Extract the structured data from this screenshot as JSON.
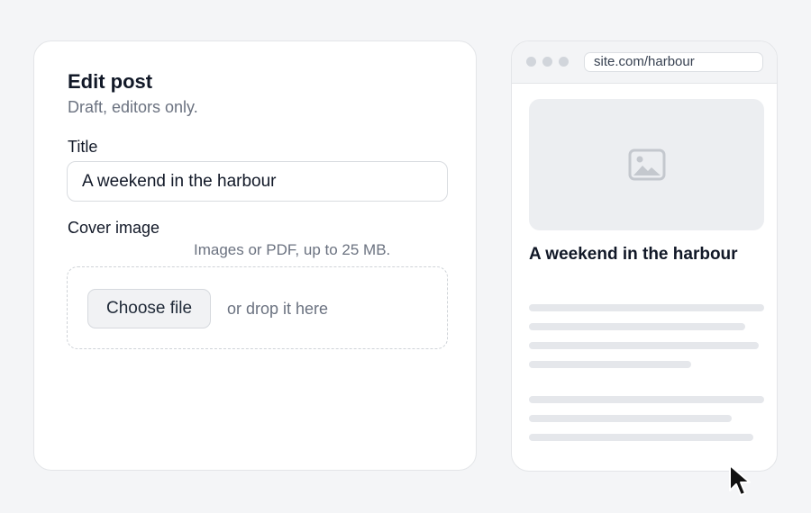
{
  "editor": {
    "title": "Edit post",
    "subtitle": "Draft, editors only.",
    "title_label": "Title",
    "title_value": "A weekend in the harbour",
    "cover_label": "Cover image",
    "cover_hint": "Images or PDF, up to 25 MB.",
    "choose_file_label": "Choose file",
    "drop_text": "or drop it here"
  },
  "preview": {
    "url": "site.com/harbour",
    "image_icon": "image-icon",
    "post_title": "A weekend in the harbour"
  },
  "icons": {
    "cursor": "mouse-pointer-icon"
  },
  "colors": {
    "background": "#f4f5f7",
    "card": "#ffffff",
    "muted_text": "#6b7280",
    "placeholder_line": "#e5e7eb"
  }
}
